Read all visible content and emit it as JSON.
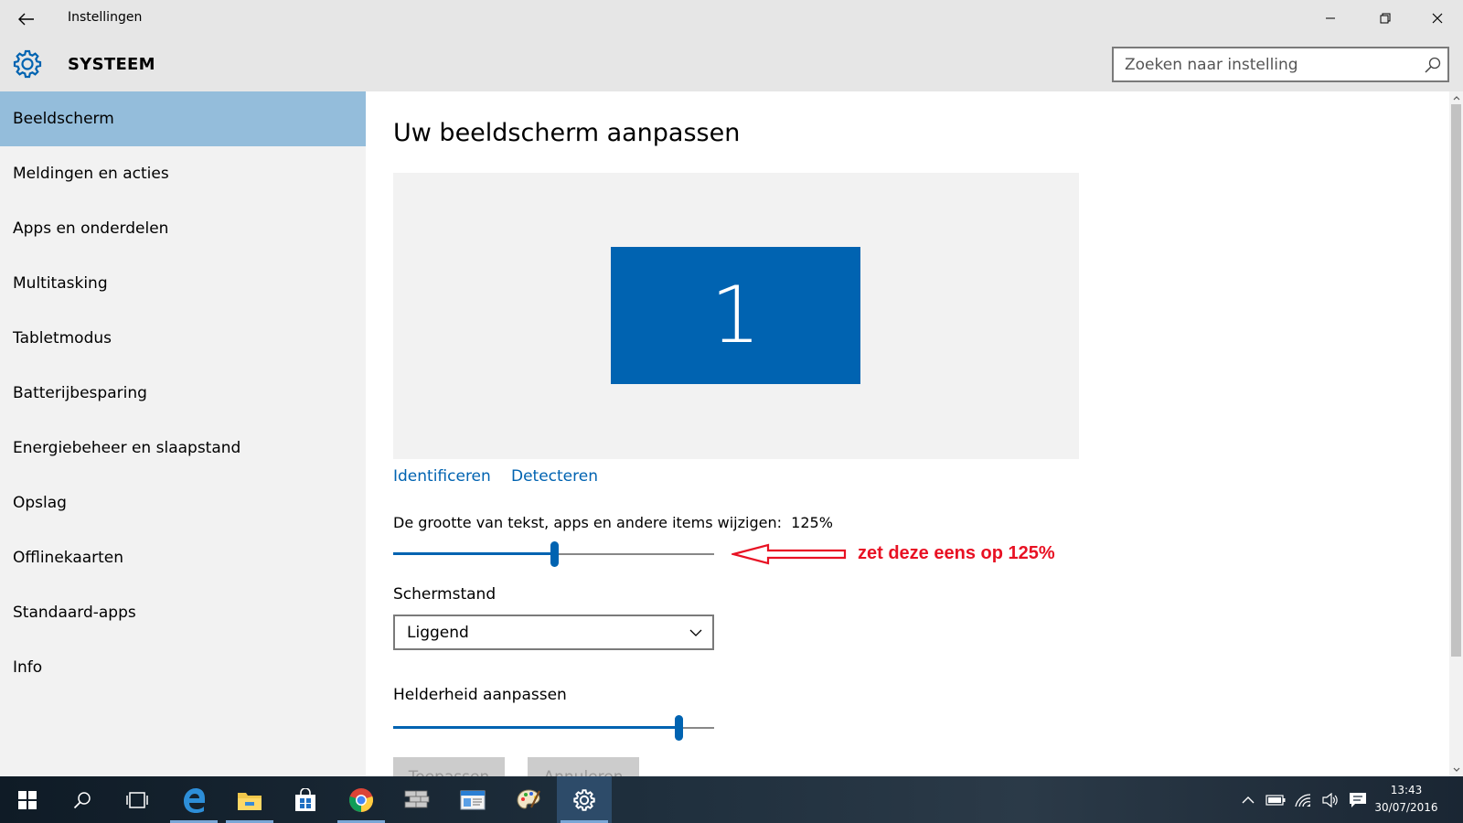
{
  "window": {
    "app_title": "Instellingen",
    "section_title": "SYSTEEM",
    "search_placeholder": "Zoeken naar instelling"
  },
  "sidebar": {
    "items": [
      {
        "label": "Beeldscherm",
        "active": true
      },
      {
        "label": "Meldingen en acties"
      },
      {
        "label": "Apps en onderdelen"
      },
      {
        "label": "Multitasking"
      },
      {
        "label": "Tabletmodus"
      },
      {
        "label": "Batterijbesparing"
      },
      {
        "label": "Energiebeheer en slaapstand"
      },
      {
        "label": "Opslag"
      },
      {
        "label": "Offlinekaarten"
      },
      {
        "label": "Standaard-apps"
      },
      {
        "label": "Info"
      }
    ]
  },
  "content": {
    "title": "Uw beeldscherm aanpassen",
    "monitor_label": "1",
    "identify_link": "Identificeren",
    "detect_link": "Detecteren",
    "scale_label": "De grootte van tekst, apps en andere items wijzigen:",
    "scale_value": "125%",
    "scale_position": 0.5,
    "annotation": "zet deze eens op 125%",
    "orientation_label": "Schermstand",
    "orientation_value": "Liggend",
    "brightness_label": "Helderheid aanpassen",
    "brightness_position": 0.89,
    "apply_button": "Toepassen",
    "cancel_button": "Annuleren"
  },
  "taskbar": {
    "apps": [
      "start",
      "search",
      "task-view",
      "edge",
      "file-explorer",
      "store",
      "chrome",
      "firewall",
      "outlook",
      "paint",
      "settings"
    ],
    "time": "13:43",
    "date": "30/07/2016"
  },
  "colors": {
    "accent": "#0063b1",
    "selected_nav": "#94bddb",
    "annotation_red": "#e81123"
  }
}
